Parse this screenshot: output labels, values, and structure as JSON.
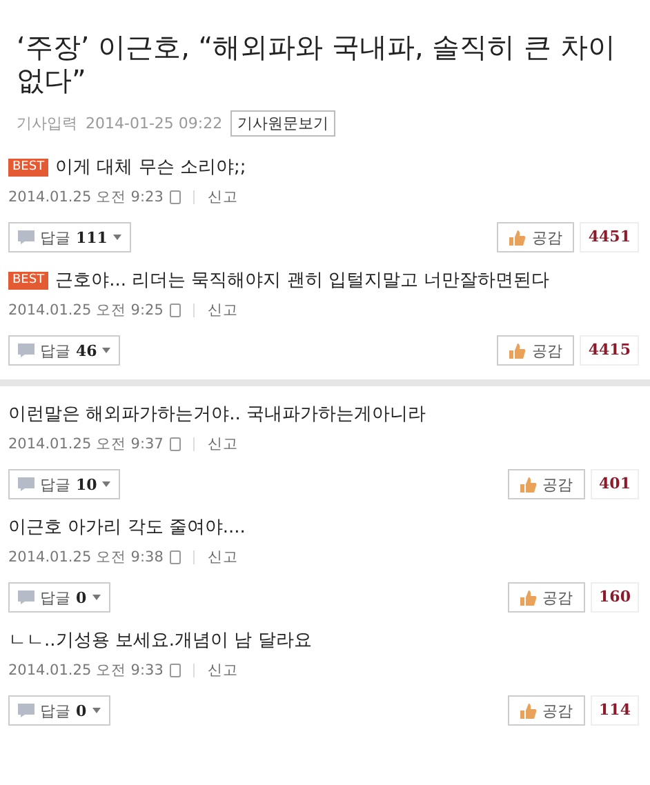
{
  "article": {
    "title": "‘주장’ 이근호, “해외파와 국내파, 솔직히 큰 차이 없다”",
    "date_label": "기사입력",
    "date": "2014-01-25 09:22",
    "source_button": "기사원문보기"
  },
  "best_comments": [
    {
      "badge": "BEST",
      "text": "이게 대체 무슨 소리야;;",
      "date": "2014.01.25 오전 9:23",
      "report": "신고",
      "reply_label": "답글",
      "reply_count": "111",
      "like_label": "공감",
      "like_count": "4451"
    },
    {
      "badge": "BEST",
      "text": "근호야... 리더는 묵직해야지 괜히 입털지말고 너만잘하면된다",
      "date": "2014.01.25 오전 9:25",
      "report": "신고",
      "reply_label": "답글",
      "reply_count": "46",
      "like_label": "공감",
      "like_count": "4415"
    }
  ],
  "comments": [
    {
      "text": "이런말은 해외파가하는거야.. 국내파가하는게아니라",
      "date": "2014.01.25 오전 9:37",
      "report": "신고",
      "reply_label": "답글",
      "reply_count": "10",
      "like_label": "공감",
      "like_count": "401"
    },
    {
      "text": "이근호 아가리 각도 줄여야....",
      "date": "2014.01.25 오전 9:38",
      "report": "신고",
      "reply_label": "답글",
      "reply_count": "0",
      "like_label": "공감",
      "like_count": "160"
    },
    {
      "text": "ㄴㄴ..기성용 보세요.개념이 남 달라요",
      "date": "2014.01.25 오전 9:33",
      "report": "신고",
      "reply_label": "답글",
      "reply_count": "0",
      "like_label": "공감",
      "like_count": "114"
    }
  ]
}
